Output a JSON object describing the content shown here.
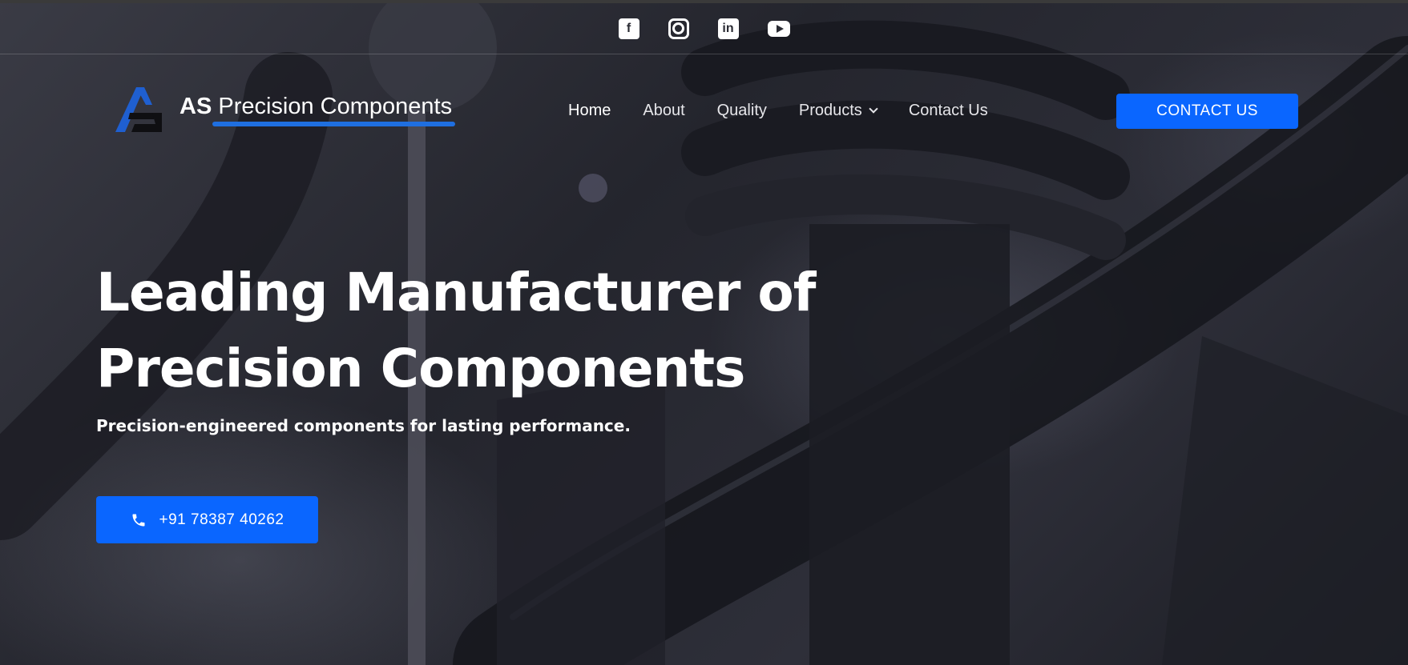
{
  "social": {
    "facebook_icon": "facebook-icon",
    "instagram_icon": "instagram-icon",
    "linkedin_icon": "linkedin-icon",
    "youtube_icon": "youtube-icon",
    "facebook_glyph": "f",
    "linkedin_glyph": "in"
  },
  "brand": {
    "bold": "AS",
    "name": " Precision Components",
    "accent_color": "#1f6fe0"
  },
  "nav": {
    "items": [
      {
        "label": "Home",
        "active": true
      },
      {
        "label": "About"
      },
      {
        "label": "Quality"
      },
      {
        "label": "Products",
        "has_dropdown": true
      },
      {
        "label": "Contact Us"
      }
    ]
  },
  "header_cta": {
    "label": "CONTACT US",
    "color": "#0a66ff"
  },
  "hero": {
    "title_line1": "Leading Manufacturer of",
    "title_line2": "Precision Components",
    "subtitle": "Precision-engineered components for lasting performance.",
    "phone_label": "+91 78387 40262",
    "phone_icon": "phone-icon"
  }
}
